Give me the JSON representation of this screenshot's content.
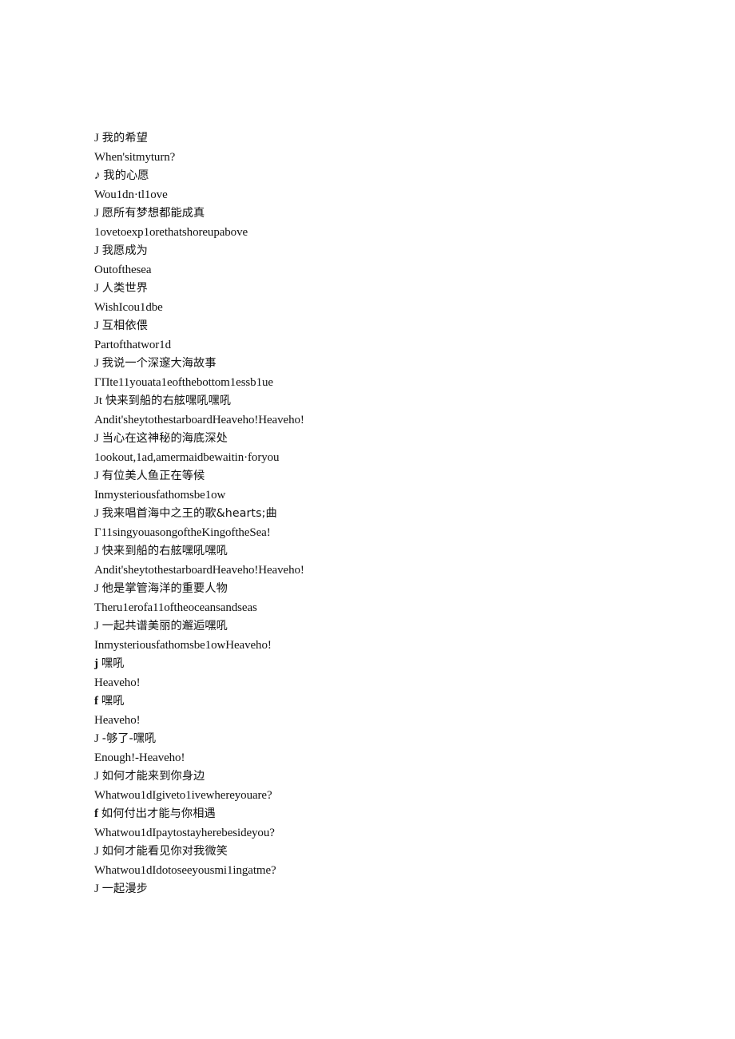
{
  "document": {
    "page_background": "#ffffff",
    "text_color": "#111111",
    "lines": [
      {
        "marker": "J",
        "marker_style": "plain",
        "text": "我的希望",
        "lang": "cn"
      },
      {
        "marker": "",
        "marker_style": "none",
        "text": "When'sitmyturn?",
        "lang": "en"
      },
      {
        "marker": "♪",
        "marker_style": "slanted",
        "text": "我的心愿",
        "lang": "cn"
      },
      {
        "marker": "",
        "marker_style": "none",
        "text": "Wou1dn·tl1ove",
        "lang": "en"
      },
      {
        "marker": "J",
        "marker_style": "plain",
        "text": "愿所有梦想都能成真",
        "lang": "cn"
      },
      {
        "marker": "",
        "marker_style": "none",
        "text": "1ovetoexp1orethatshoreupabove",
        "lang": "en"
      },
      {
        "marker": "J",
        "marker_style": "plain",
        "text": "我愿成为",
        "lang": "cn"
      },
      {
        "marker": "",
        "marker_style": "none",
        "text": "Outofthesea",
        "lang": "en"
      },
      {
        "marker": "J",
        "marker_style": "plain",
        "text": "人类世界",
        "lang": "cn"
      },
      {
        "marker": "",
        "marker_style": "none",
        "text": "WishIcou1dbe",
        "lang": "en"
      },
      {
        "marker": "J",
        "marker_style": "plain",
        "text": "互相依偎",
        "lang": "cn"
      },
      {
        "marker": "",
        "marker_style": "none",
        "text": "Partofthatwor1d",
        "lang": "en"
      },
      {
        "marker": "J",
        "marker_style": "plain",
        "text": "我说一个深邃大海故事",
        "lang": "cn"
      },
      {
        "marker": "",
        "marker_style": "none",
        "text": "ГПte11youata1eofthebottom1essb1ue",
        "lang": "en"
      },
      {
        "marker": "Jt",
        "marker_style": "plain",
        "text": "快来到船的右舷嘿吼嘿吼",
        "lang": "cn"
      },
      {
        "marker": "",
        "marker_style": "none",
        "text": "Andit'sheytothestarboardHeaveho!Heaveho!",
        "lang": "en"
      },
      {
        "marker": "J",
        "marker_style": "plain",
        "text": "当心在这神秘的海底深处",
        "lang": "cn"
      },
      {
        "marker": "",
        "marker_style": "none",
        "text": "1ookout,1ad,amermaidbewaitin·foryou",
        "lang": "en"
      },
      {
        "marker": "J",
        "marker_style": "plain",
        "text": "有位美人鱼正在等候",
        "lang": "cn"
      },
      {
        "marker": "",
        "marker_style": "none",
        "text": "Inmysteriousfathomsbe1ow",
        "lang": "en"
      },
      {
        "marker": "J",
        "marker_style": "plain",
        "text": "我来唱首海中之王的歌&hearts;曲",
        "lang": "cn"
      },
      {
        "marker": "",
        "marker_style": "none",
        "text": "Г11singyouasongoftheKingoftheSea!",
        "lang": "en"
      },
      {
        "marker": "J",
        "marker_style": "plain",
        "text": "快来到船的右舷嘿吼嘿吼",
        "lang": "cn"
      },
      {
        "marker": "",
        "marker_style": "none",
        "text": "Andit'sheytothestarboardHeaveho!Heaveho!",
        "lang": "en"
      },
      {
        "marker": "J",
        "marker_style": "plain",
        "text": "他是掌管海洋的重要人物",
        "lang": "cn"
      },
      {
        "marker": "",
        "marker_style": "none",
        "text": "Theru1erofa11oftheoceansandseas",
        "lang": "en"
      },
      {
        "marker": "J",
        "marker_style": "plain",
        "text": "一起共谱美丽的邂逅嘿吼",
        "lang": "cn"
      },
      {
        "marker": "",
        "marker_style": "none",
        "text": "Inmysteriousfathomsbe1owHeaveho!",
        "lang": "en"
      },
      {
        "marker": "j",
        "marker_style": "bold",
        "text": "嘿吼",
        "lang": "cn"
      },
      {
        "marker": "",
        "marker_style": "none",
        "text": "Heaveho!",
        "lang": "en"
      },
      {
        "marker": "f",
        "marker_style": "bold",
        "text": "嘿吼",
        "lang": "cn"
      },
      {
        "marker": "",
        "marker_style": "none",
        "text": "Heaveho!",
        "lang": "en"
      },
      {
        "marker": "J",
        "marker_style": "plain",
        "text": "-够了-嘿吼",
        "lang": "cn"
      },
      {
        "marker": "",
        "marker_style": "none",
        "text": "Enough!-Heaveho!",
        "lang": "en"
      },
      {
        "marker": "J",
        "marker_style": "plain",
        "text": "如何才能来到你身边",
        "lang": "cn"
      },
      {
        "marker": "",
        "marker_style": "none",
        "text": "Whatwou1dIgiveto1ivewhereyouare?",
        "lang": "en"
      },
      {
        "marker": "f",
        "marker_style": "bold",
        "text": "如何付出才能与你相遇",
        "lang": "cn"
      },
      {
        "marker": "",
        "marker_style": "none",
        "text": "Whatwou1dIpaytostayherebesideyou?",
        "lang": "en"
      },
      {
        "marker": "J",
        "marker_style": "plain",
        "text": "如何才能看见你对我微笑",
        "lang": "cn"
      },
      {
        "marker": "",
        "marker_style": "none",
        "text": "Whatwou1dIdotoseeyousmi1ingatme?",
        "lang": "en"
      },
      {
        "marker": "J",
        "marker_style": "plain",
        "text": "一起漫步",
        "lang": "cn"
      }
    ]
  }
}
